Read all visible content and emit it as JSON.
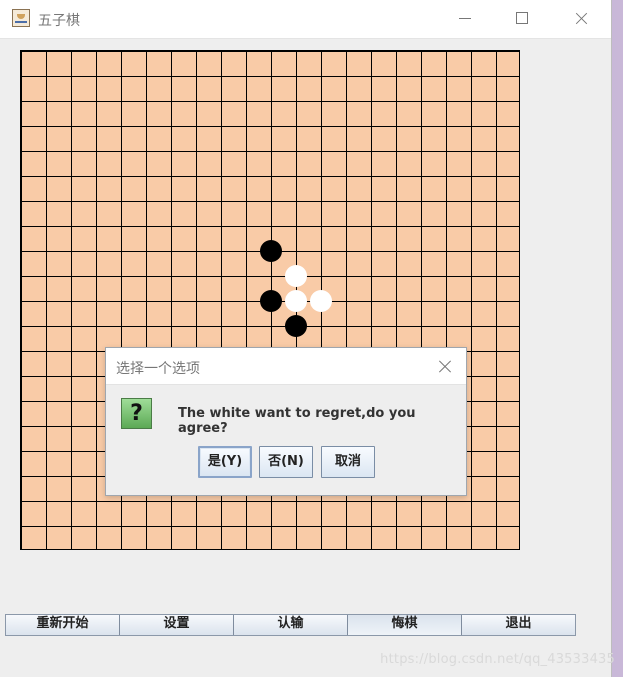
{
  "window": {
    "title": "五子棋",
    "icon": "java-cup-icon"
  },
  "board": {
    "grid_lines": 20,
    "stones": [
      {
        "color": "black",
        "col": 10,
        "row": 8
      },
      {
        "color": "white",
        "col": 11,
        "row": 9
      },
      {
        "color": "black",
        "col": 10,
        "row": 10
      },
      {
        "color": "white",
        "col": 11,
        "row": 10
      },
      {
        "color": "white",
        "col": 12,
        "row": 10
      },
      {
        "color": "black",
        "col": 11,
        "row": 11
      }
    ]
  },
  "dialog": {
    "title": "选择一个选项",
    "message": "The white want to regret,do you agree?",
    "icon": "question-icon",
    "buttons": [
      {
        "label": "是(Y)"
      },
      {
        "label": "否(N)"
      },
      {
        "label": "取消"
      }
    ]
  },
  "toolbar": {
    "buttons": [
      {
        "label": "重新开始"
      },
      {
        "label": "设置"
      },
      {
        "label": "认输"
      },
      {
        "label": "悔棋"
      },
      {
        "label": "退出"
      }
    ]
  },
  "watermark": "https://blog.csdn.net/qq_43533435"
}
